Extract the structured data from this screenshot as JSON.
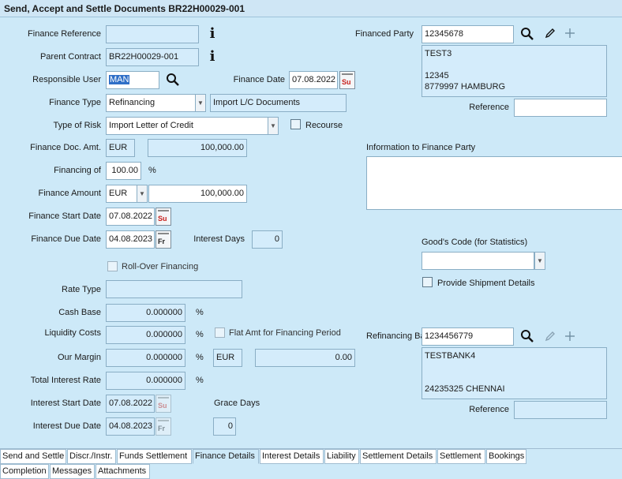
{
  "title": "Send, Accept and Settle Documents BR22H00029-001",
  "left": {
    "finance_reference": {
      "label": "Finance Reference",
      "value": ""
    },
    "parent_contract": {
      "label": "Parent Contract",
      "value": "BR22H00029-001"
    },
    "responsible_user": {
      "label": "Responsible User",
      "value": "MAN"
    },
    "finance_date": {
      "label": "Finance Date",
      "value": "07.08.2022",
      "day": "Su"
    },
    "finance_type": {
      "label": "Finance Type",
      "value": "Refinancing",
      "description": "Import L/C Documents"
    },
    "type_of_risk": {
      "label": "Type of Risk",
      "value": "Import Letter of Credit"
    },
    "recourse": {
      "label": "Recourse"
    },
    "finance_doc_amt": {
      "label": "Finance Doc. Amt.",
      "currency": "EUR",
      "value": "100,000.00"
    },
    "financing_of": {
      "label": "Financing of",
      "value": "100.00",
      "unit": "%"
    },
    "finance_amount": {
      "label": "Finance Amount",
      "currency": "EUR",
      "value": "100,000.00"
    },
    "finance_start_date": {
      "label": "Finance Start Date",
      "value": "07.08.2022",
      "day": "Su"
    },
    "finance_due_date": {
      "label": "Finance Due Date",
      "value": "04.08.2023",
      "day": "Fr"
    },
    "interest_days": {
      "label": "Interest Days",
      "value": "0"
    },
    "roll_over": {
      "label": "Roll-Over Financing"
    },
    "rate_type": {
      "label": "Rate Type",
      "value": ""
    },
    "cash_base": {
      "label": "Cash Base",
      "value": "0.000000",
      "unit": "%"
    },
    "liquidity_costs": {
      "label": "Liquidity Costs",
      "value": "0.000000",
      "unit": "%"
    },
    "flat_amt": {
      "label": "Flat Amt for Financing Period"
    },
    "our_margin": {
      "label": "Our Margin",
      "value": "0.000000",
      "unit": "%",
      "currency": "EUR",
      "amount": "0.00"
    },
    "total_interest_rate": {
      "label": "Total Interest Rate",
      "value": "0.000000",
      "unit": "%"
    },
    "interest_start_date": {
      "label": "Interest Start Date",
      "value": "07.08.2022",
      "day": "Su"
    },
    "interest_due_date": {
      "label": "Interest Due Date",
      "value": "04.08.2023",
      "day": "Fr"
    },
    "grace_days": {
      "label": "Grace Days",
      "value": "0"
    }
  },
  "right": {
    "financed_party": {
      "label": "Financed Party",
      "value": "12345678",
      "address": "TEST3\n\n12345\n8779997 HAMBURG",
      "reference_label": "Reference",
      "reference_value": ""
    },
    "information_to_finance_party": {
      "label": "Information to Finance Party",
      "value": ""
    },
    "goods_code": {
      "label": "Good's Code (for Statistics)",
      "value": ""
    },
    "provide_shipment": {
      "label": "Provide Shipment Details"
    },
    "refinancing_bank": {
      "label": "Refinancing Bank",
      "value": "1234456779",
      "address": "TESTBANK4\n\n\n24235325 CHENNAI",
      "reference_label": "Reference",
      "reference_value": ""
    }
  },
  "tabs_row1": [
    "Send and Settle",
    "Discr./Instr.",
    "Funds Settlement",
    "Finance Details",
    "Interest Details",
    "Liability",
    "Settlement Details",
    "Settlement",
    "Bookings"
  ],
  "tabs_row2": [
    "Completion",
    "Messages",
    "Attachments"
  ],
  "active_tab": "Finance Details",
  "colors": {
    "background": "#cde9f8",
    "field": "#d4ecfb",
    "calendar_red": "#c8211c",
    "selection": "#2f6fc7"
  }
}
